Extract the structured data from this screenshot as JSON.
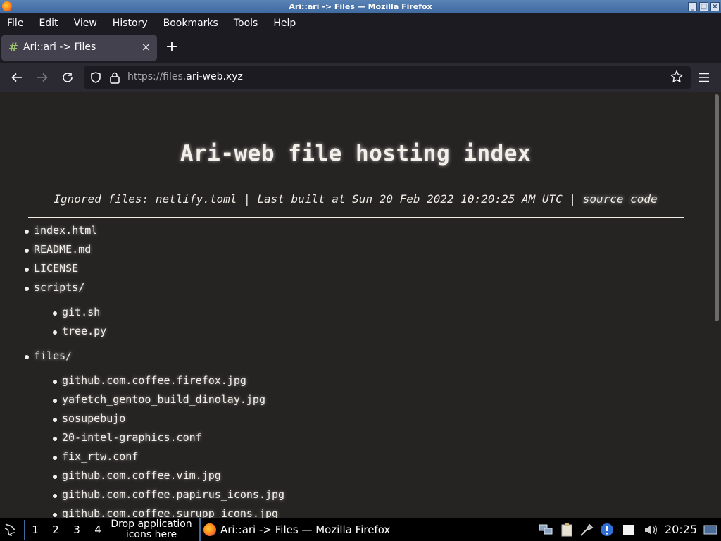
{
  "window": {
    "title": "Ari::ari -> Files — Mozilla Firefox"
  },
  "menubar": {
    "items": [
      {
        "label": "File"
      },
      {
        "label": "Edit"
      },
      {
        "label": "View"
      },
      {
        "label": "History"
      },
      {
        "label": "Bookmarks"
      },
      {
        "label": "Tools"
      },
      {
        "label": "Help"
      }
    ]
  },
  "tab": {
    "label": "Ari::ari -> Files",
    "favicon": "#"
  },
  "urlbar": {
    "scheme": "https://files.",
    "host": "ari-web.xyz"
  },
  "page": {
    "heading": "Ari-web file hosting index",
    "meta_prefix": "Ignored files: netlify.toml | Last built at Sun 20 Feb 2022 10:20:25 AM UTC | ",
    "source_link": "source code",
    "files": [
      "index.html",
      "README.md",
      "LICENSE",
      "scripts/",
      "git.sh",
      "tree.py",
      "files/",
      "github.com.coffee.firefox.jpg",
      "yafetch_gentoo_build_dinolay.jpg",
      "sosupebujo",
      "20-intel-graphics.conf",
      "fix_rtw.conf",
      "github.com.coffee.vim.jpg",
      "github.com.coffee.papirus_icons.jpg",
      "github.com.coffee.surupp_icons.jpg"
    ]
  },
  "taskbar": {
    "workspaces": [
      "1",
      "2",
      "3",
      "4"
    ],
    "drop_hint": "Drop application icons here",
    "task_label": "Ari::ari -> Files — Mozilla Firefox",
    "clock": "20:25"
  }
}
